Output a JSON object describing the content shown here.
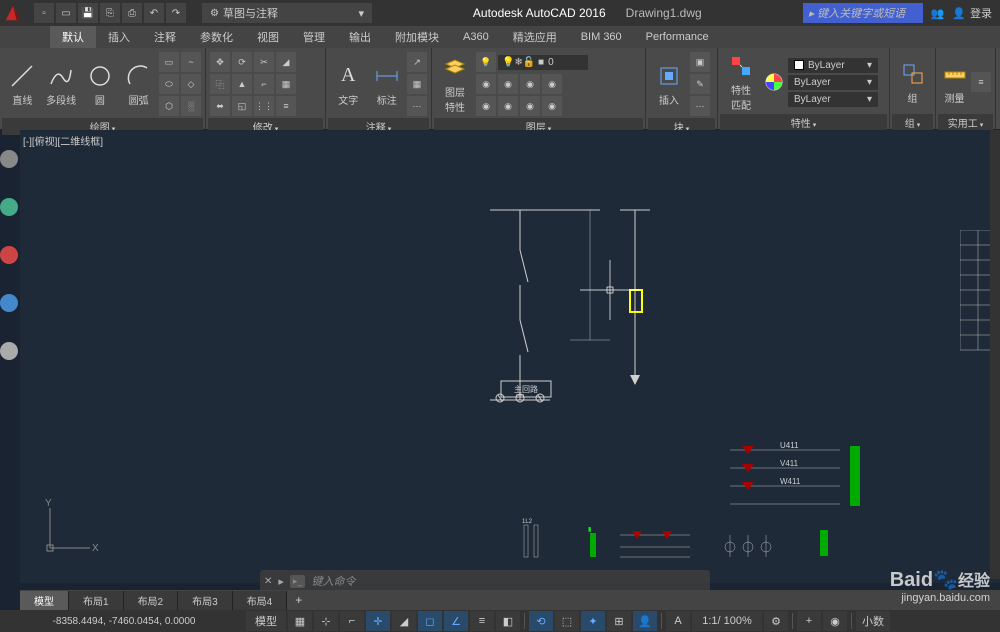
{
  "title": {
    "app": "Autodesk AutoCAD 2016",
    "file": "Drawing1.dwg"
  },
  "search": {
    "placeholder": "键入关键字或短语"
  },
  "login": {
    "label": "登录"
  },
  "workspace": {
    "label": "草图与注释"
  },
  "tabs": [
    "默认",
    "插入",
    "注释",
    "参数化",
    "视图",
    "管理",
    "输出",
    "附加模块",
    "A360",
    "精选应用",
    "BIM 360",
    "Performance"
  ],
  "panels": {
    "draw": {
      "label": "绘图",
      "btns": [
        "直线",
        "多段线",
        "圆",
        "圆弧"
      ]
    },
    "modify": {
      "label": "修改"
    },
    "annot": {
      "label": "注释",
      "btns": [
        "文字",
        "标注"
      ]
    },
    "layers": {
      "label": "图层",
      "btn": "图层\n特性",
      "current": "0"
    },
    "block": {
      "label": "块",
      "btn": "插入"
    },
    "props": {
      "label": "特性",
      "btn": "特性\n匹配",
      "vals": [
        "ByLayer",
        "ByLayer",
        "ByLayer"
      ]
    },
    "group": {
      "label": "组",
      "btn": "组"
    },
    "util": {
      "label": "实用工",
      "btn": "测量"
    }
  },
  "viewport": "[-][俯视][二维线框]",
  "circuit_label": "主回路",
  "labels": {
    "v411": "V411",
    "w411": "W411",
    "u411": "U411"
  },
  "cmdline": {
    "placeholder": "键入命令"
  },
  "layout_tabs": [
    "模型",
    "布局1",
    "布局2",
    "布局3",
    "布局4"
  ],
  "status": {
    "coords": "-8358.4494, -7460.0454, 0.0000",
    "model": "模型",
    "scale": "1:1/ 100%",
    "dec": "小数"
  },
  "watermark": {
    "brand": "Baid",
    "cn": "经验",
    "url": "jingyan.baidu.com"
  }
}
